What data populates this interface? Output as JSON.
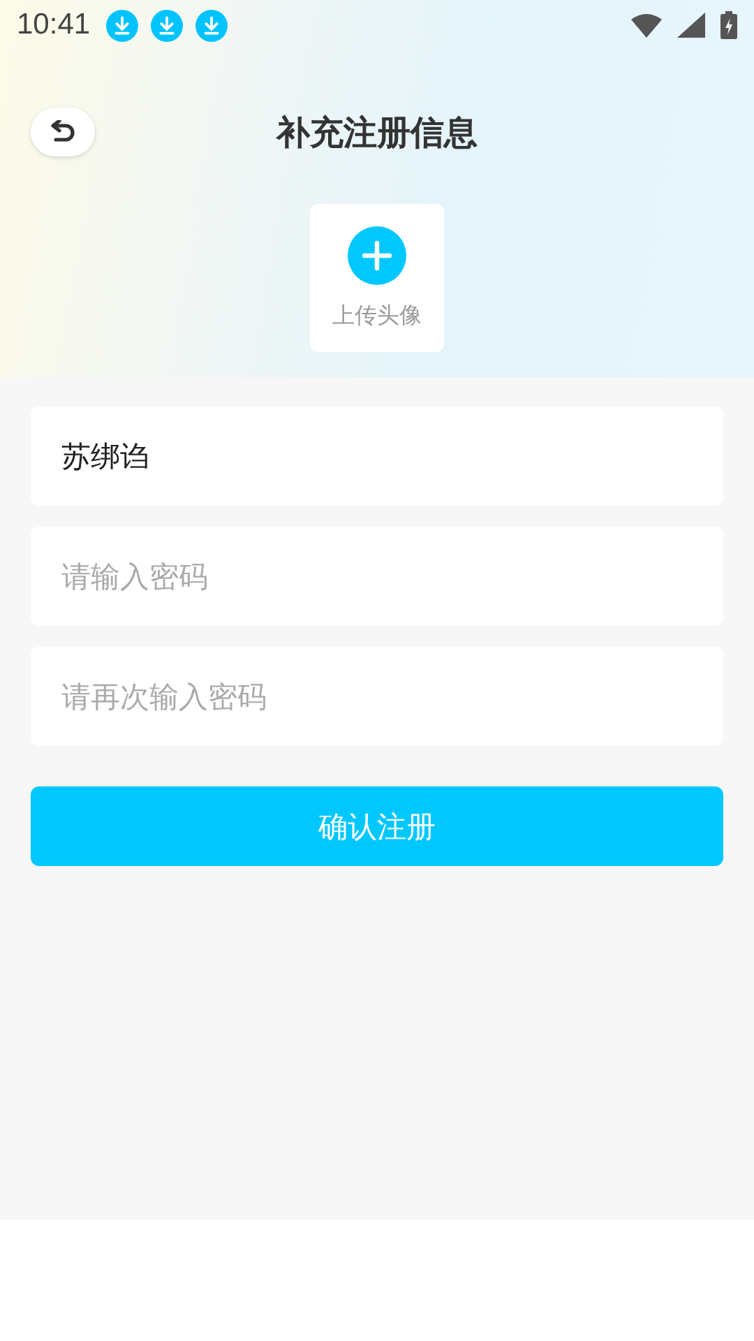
{
  "status_bar": {
    "time": "10:41"
  },
  "header": {
    "title": "补充注册信息"
  },
  "avatar_upload": {
    "label": "上传头像"
  },
  "fields": [
    {
      "value": "苏绑诌"
    },
    {
      "placeholder": "请输入密码"
    },
    {
      "placeholder": "请再次输入密码"
    }
  ],
  "submit_button": {
    "label": "确认注册"
  }
}
